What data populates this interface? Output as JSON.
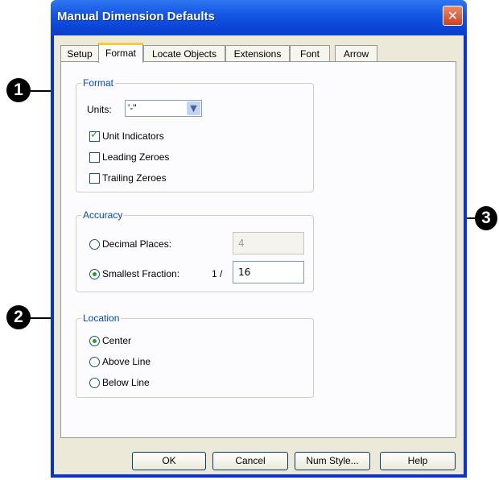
{
  "window": {
    "title": "Manual Dimension Defaults",
    "close_glyph": "✕"
  },
  "tabs": [
    "Setup",
    "Format",
    "Locate Objects",
    "Extensions",
    "Font",
    "Arrow"
  ],
  "active_tab": "Format",
  "format_group": {
    "label": "Format",
    "units_label": "Units:",
    "units_value": "'-\"",
    "unit_indicators": {
      "label": "Unit Indicators",
      "checked": true
    },
    "leading_zeroes": {
      "label": "Leading Zeroes",
      "checked": false
    },
    "trailing_zeroes": {
      "label": "Trailing Zeroes",
      "checked": false
    }
  },
  "accuracy_group": {
    "label": "Accuracy",
    "decimal_places": {
      "label": "Decimal Places:",
      "selected": false,
      "value": "4"
    },
    "smallest_fraction": {
      "label": "Smallest Fraction:",
      "selected": true,
      "prefix": "1 /",
      "value": "16"
    }
  },
  "location_group": {
    "label": "Location",
    "options": [
      {
        "label": "Center",
        "selected": true
      },
      {
        "label": "Above Line",
        "selected": false
      },
      {
        "label": "Below Line",
        "selected": false
      }
    ]
  },
  "buttons": {
    "ok": "OK",
    "cancel": "Cancel",
    "num_style": "Num Style...",
    "help": "Help"
  },
  "callouts": {
    "one": "1",
    "two": "2",
    "three": "3"
  }
}
